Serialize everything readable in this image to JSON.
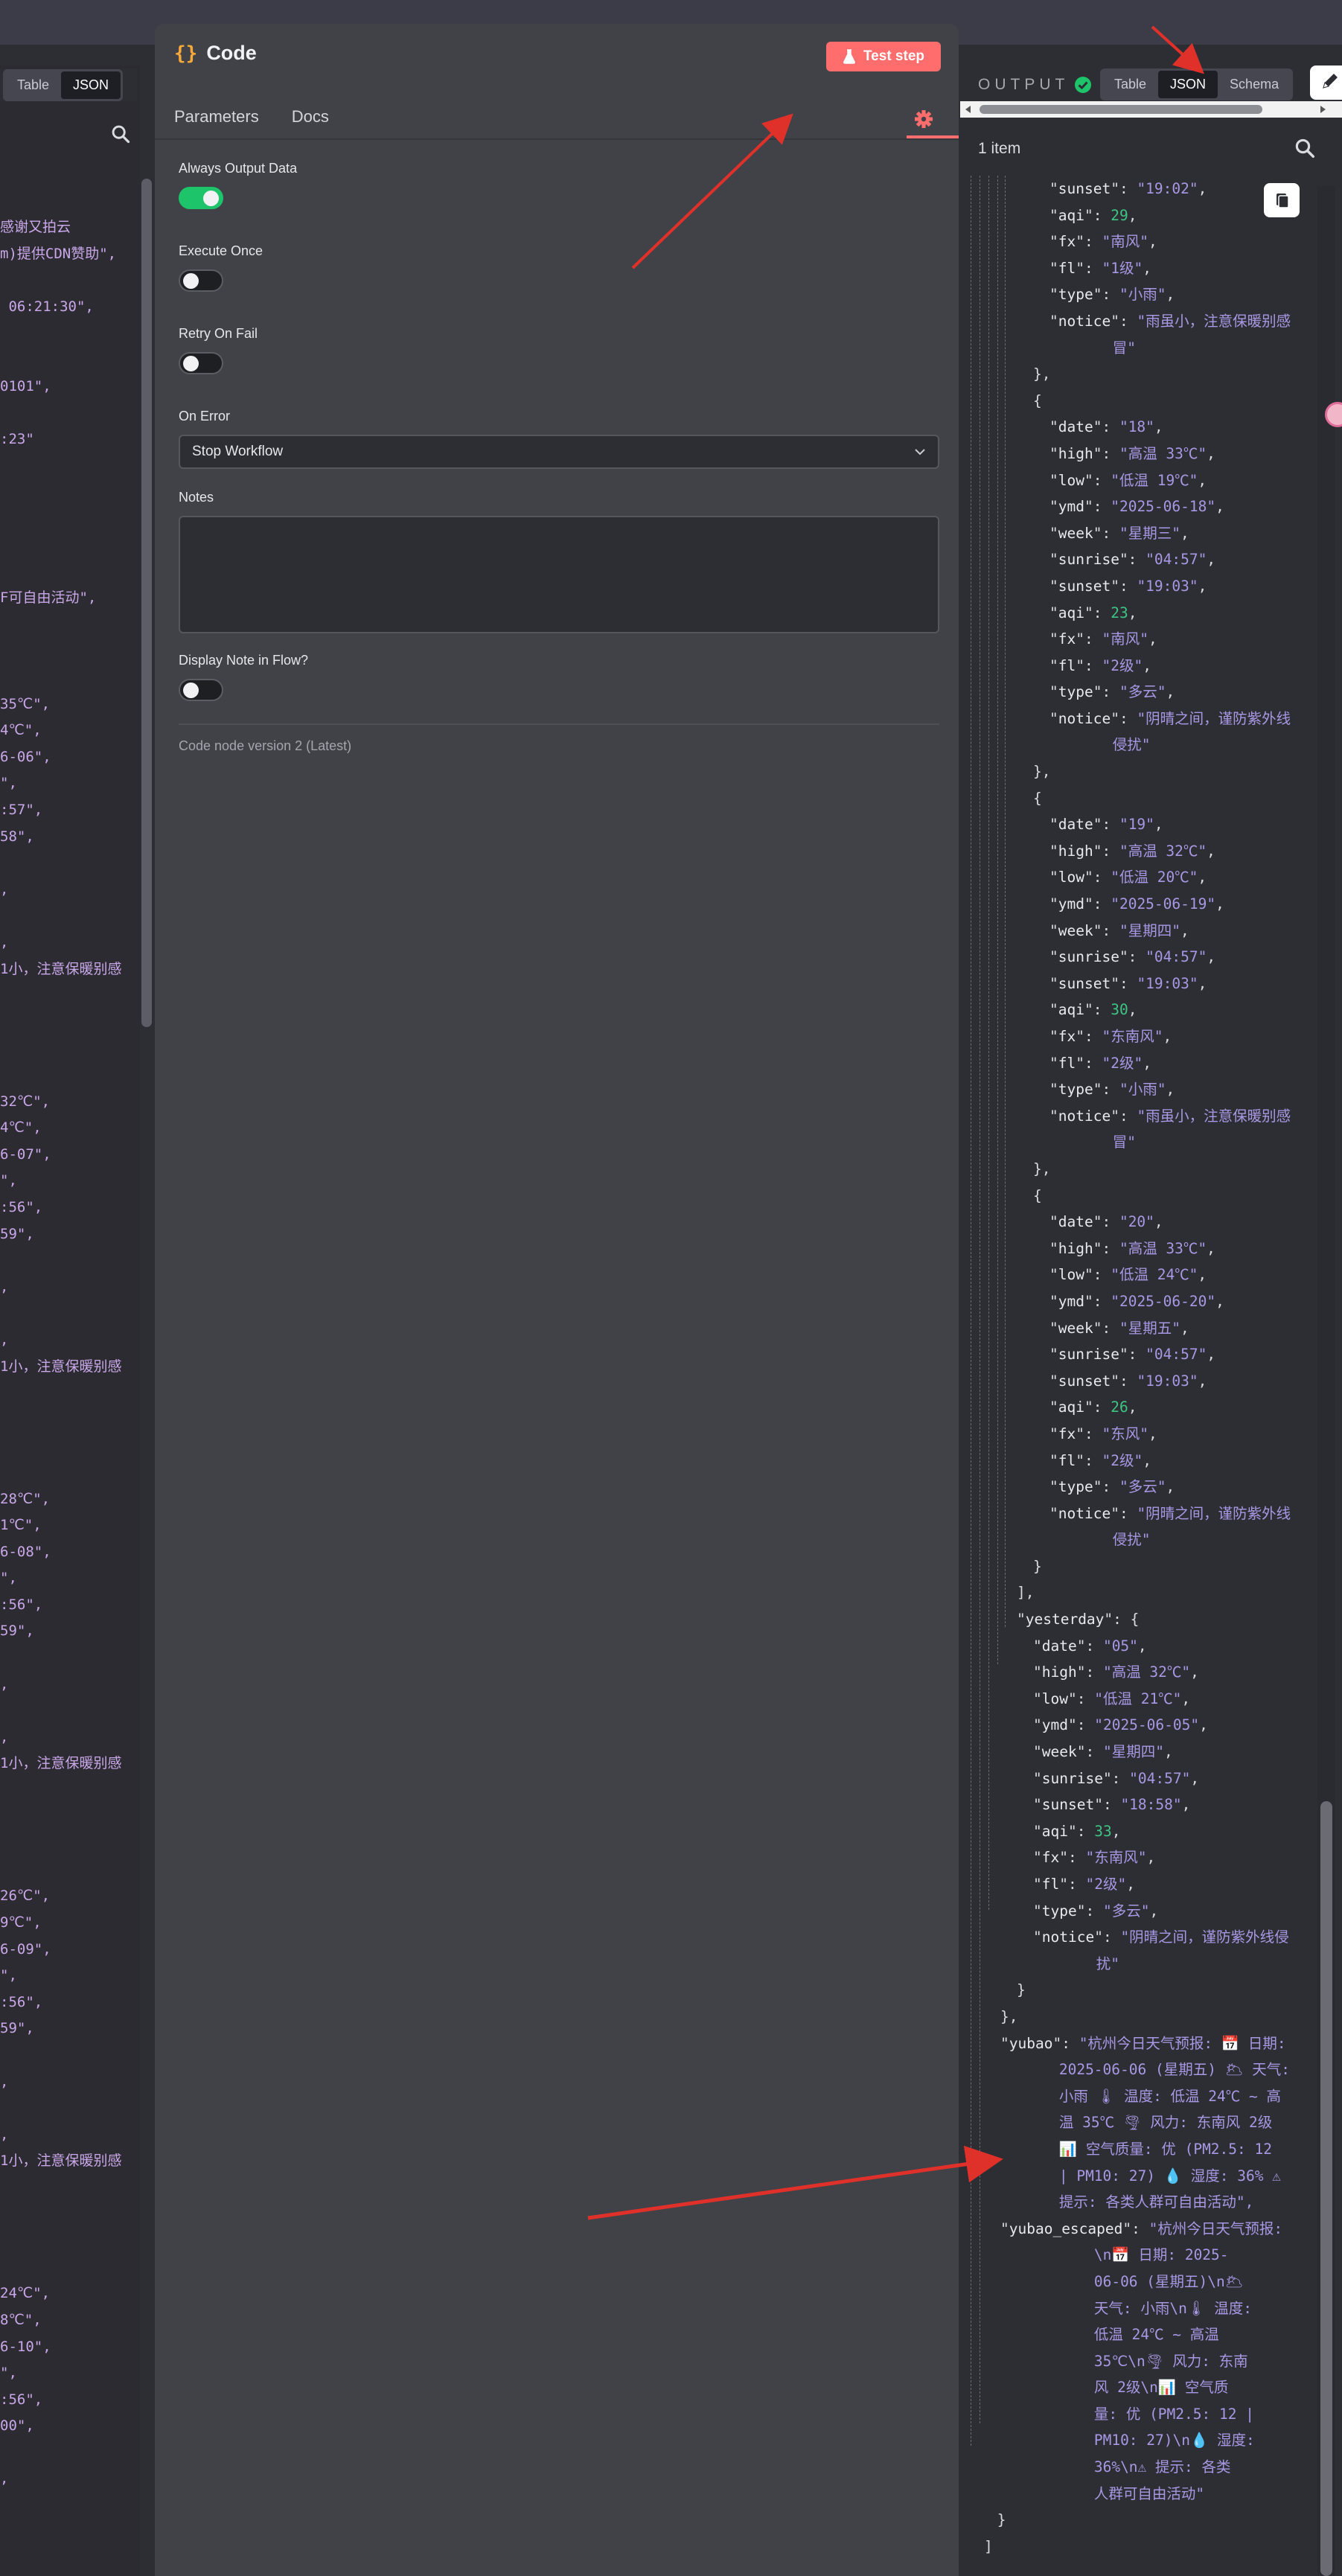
{
  "input_panel": {
    "view_toggle": {
      "table": "Table",
      "json": "JSON",
      "active": "JSON"
    },
    "code_fragments": [
      "感谢又拍云",
      "m)提供CDN赞助\",",
      "",
      " 06:21:30\",",
      "",
      "",
      "0101\",",
      "",
      ":23\"",
      "",
      "",
      "",
      "",
      "",
      "F可自由活动\",",
      "",
      "",
      "",
      "35℃\",",
      "4℃\",",
      "6-06\",",
      "\",",
      ":57\",",
      "58\",",
      "",
      ",",
      "",
      ",",
      "1小，注意保暖别感",
      "",
      "",
      "",
      "",
      "32℃\",",
      "4℃\",",
      "6-07\",",
      "\",",
      ":56\",",
      "59\",",
      "",
      ",",
      "",
      ",",
      "1小，注意保暖别感",
      "",
      "",
      "",
      "",
      "28℃\",",
      "1℃\",",
      "6-08\",",
      "\",",
      ":56\",",
      "59\",",
      "",
      ",",
      "",
      ",",
      "1小，注意保暖别感",
      "",
      "",
      "",
      "",
      "26℃\",",
      "9℃\",",
      "6-09\",",
      "\",",
      ":56\",",
      "59\",",
      "",
      ",",
      "",
      ",",
      "1小，注意保暖别感",
      "",
      "",
      "",
      "",
      "24℃\",",
      "8℃\",",
      "6-10\",",
      "\",",
      ":56\",",
      "00\",",
      "",
      ","
    ]
  },
  "node": {
    "title": "Code",
    "test_button": "Test step",
    "tabs": {
      "parameters": "Parameters",
      "docs": "Docs"
    },
    "settings": {
      "always_output_data": {
        "label": "Always Output Data",
        "on": true
      },
      "execute_once": {
        "label": "Execute Once",
        "on": false
      },
      "retry_on_fail": {
        "label": "Retry On Fail",
        "on": false
      },
      "on_error": {
        "label": "On Error",
        "value": "Stop Workflow"
      },
      "notes": {
        "label": "Notes",
        "value": ""
      },
      "display_note": {
        "label": "Display Note in Flow?",
        "on": false
      }
    },
    "version": "Code node version 2 (Latest)"
  },
  "output_panel": {
    "label": "OUTPUT",
    "view_toggle": {
      "table": "Table",
      "json": "JSON",
      "schema": "Schema",
      "active": "JSON"
    },
    "items_count": "1 item",
    "json_lines": [
      {
        "d": 4,
        "k": "sunset",
        "v": "\"19:02\"",
        "t": "s",
        "c": true
      },
      {
        "d": 4,
        "k": "aqi",
        "v": "29",
        "t": "n",
        "c": true
      },
      {
        "d": 4,
        "k": "fx",
        "v": "\"南风\"",
        "t": "s",
        "c": true
      },
      {
        "d": 4,
        "k": "fl",
        "v": "\"1级\"",
        "t": "s",
        "c": true
      },
      {
        "d": 4,
        "k": "type",
        "v": "\"小雨\"",
        "t": "s",
        "c": true
      },
      {
        "d": 4,
        "k": "notice",
        "v": "\"雨虽小，注意保暖别感",
        "t": "s",
        "c": false
      },
      {
        "d": 4,
        "w": 6.7,
        "v": "冒\"",
        "t": "s"
      },
      {
        "d": 3,
        "p": "},"
      },
      {
        "d": 3,
        "p": "{"
      },
      {
        "d": 4,
        "k": "date",
        "v": "\"18\"",
        "t": "s",
        "c": true
      },
      {
        "d": 4,
        "k": "high",
        "v": "\"高温 33℃\"",
        "t": "s",
        "c": true
      },
      {
        "d": 4,
        "k": "low",
        "v": "\"低温 19℃\"",
        "t": "s",
        "c": true
      },
      {
        "d": 4,
        "k": "ymd",
        "v": "\"2025-06-18\"",
        "t": "s",
        "c": true
      },
      {
        "d": 4,
        "k": "week",
        "v": "\"星期三\"",
        "t": "s",
        "c": true
      },
      {
        "d": 4,
        "k": "sunrise",
        "v": "\"04:57\"",
        "t": "s",
        "c": true
      },
      {
        "d": 4,
        "k": "sunset",
        "v": "\"19:03\"",
        "t": "s",
        "c": true
      },
      {
        "d": 4,
        "k": "aqi",
        "v": "23",
        "t": "n",
        "c": true
      },
      {
        "d": 4,
        "k": "fx",
        "v": "\"南风\"",
        "t": "s",
        "c": true
      },
      {
        "d": 4,
        "k": "fl",
        "v": "\"2级\"",
        "t": "s",
        "c": true
      },
      {
        "d": 4,
        "k": "type",
        "v": "\"多云\"",
        "t": "s",
        "c": true
      },
      {
        "d": 4,
        "k": "notice",
        "v": "\"阴晴之间，谨防紫外线",
        "t": "s",
        "c": false
      },
      {
        "d": 4,
        "w": 6.7,
        "v": "侵扰\"",
        "t": "s"
      },
      {
        "d": 3,
        "p": "},"
      },
      {
        "d": 3,
        "p": "{"
      },
      {
        "d": 4,
        "k": "date",
        "v": "\"19\"",
        "t": "s",
        "c": true
      },
      {
        "d": 4,
        "k": "high",
        "v": "\"高温 32℃\"",
        "t": "s",
        "c": true
      },
      {
        "d": 4,
        "k": "low",
        "v": "\"低温 20℃\"",
        "t": "s",
        "c": true
      },
      {
        "d": 4,
        "k": "ymd",
        "v": "\"2025-06-19\"",
        "t": "s",
        "c": true
      },
      {
        "d": 4,
        "k": "week",
        "v": "\"星期四\"",
        "t": "s",
        "c": true
      },
      {
        "d": 4,
        "k": "sunrise",
        "v": "\"04:57\"",
        "t": "s",
        "c": true
      },
      {
        "d": 4,
        "k": "sunset",
        "v": "\"19:03\"",
        "t": "s",
        "c": true
      },
      {
        "d": 4,
        "k": "aqi",
        "v": "30",
        "t": "n",
        "c": true
      },
      {
        "d": 4,
        "k": "fx",
        "v": "\"东南风\"",
        "t": "s",
        "c": true
      },
      {
        "d": 4,
        "k": "fl",
        "v": "\"2级\"",
        "t": "s",
        "c": true
      },
      {
        "d": 4,
        "k": "type",
        "v": "\"小雨\"",
        "t": "s",
        "c": true
      },
      {
        "d": 4,
        "k": "notice",
        "v": "\"雨虽小，注意保暖别感",
        "t": "s",
        "c": false
      },
      {
        "d": 4,
        "w": 6.7,
        "v": "冒\"",
        "t": "s"
      },
      {
        "d": 3,
        "p": "},"
      },
      {
        "d": 3,
        "p": "{"
      },
      {
        "d": 4,
        "k": "date",
        "v": "\"20\"",
        "t": "s",
        "c": true
      },
      {
        "d": 4,
        "k": "high",
        "v": "\"高温 33℃\"",
        "t": "s",
        "c": true
      },
      {
        "d": 4,
        "k": "low",
        "v": "\"低温 24℃\"",
        "t": "s",
        "c": true
      },
      {
        "d": 4,
        "k": "ymd",
        "v": "\"2025-06-20\"",
        "t": "s",
        "c": true
      },
      {
        "d": 4,
        "k": "week",
        "v": "\"星期五\"",
        "t": "s",
        "c": true
      },
      {
        "d": 4,
        "k": "sunrise",
        "v": "\"04:57\"",
        "t": "s",
        "c": true
      },
      {
        "d": 4,
        "k": "sunset",
        "v": "\"19:03\"",
        "t": "s",
        "c": true
      },
      {
        "d": 4,
        "k": "aqi",
        "v": "26",
        "t": "n",
        "c": true
      },
      {
        "d": 4,
        "k": "fx",
        "v": "\"东风\"",
        "t": "s",
        "c": true
      },
      {
        "d": 4,
        "k": "fl",
        "v": "\"2级\"",
        "t": "s",
        "c": true
      },
      {
        "d": 4,
        "k": "type",
        "v": "\"多云\"",
        "t": "s",
        "c": true
      },
      {
        "d": 4,
        "k": "notice",
        "v": "\"阴晴之间，谨防紫外线",
        "t": "s",
        "c": false
      },
      {
        "d": 4,
        "w": 6.7,
        "v": "侵扰\"",
        "t": "s"
      },
      {
        "d": 3,
        "p": "}"
      },
      {
        "d": 2,
        "p": "],"
      },
      {
        "d": 2,
        "k": "yesterday",
        "v": "{",
        "t": "p",
        "c": false
      },
      {
        "d": 3,
        "k": "date",
        "v": "\"05\"",
        "t": "s",
        "c": true
      },
      {
        "d": 3,
        "k": "high",
        "v": "\"高温 32℃\"",
        "t": "s",
        "c": true
      },
      {
        "d": 3,
        "k": "low",
        "v": "\"低温 21℃\"",
        "t": "s",
        "c": true
      },
      {
        "d": 3,
        "k": "ymd",
        "v": "\"2025-06-05\"",
        "t": "s",
        "c": true
      },
      {
        "d": 3,
        "k": "week",
        "v": "\"星期四\"",
        "t": "s",
        "c": true
      },
      {
        "d": 3,
        "k": "sunrise",
        "v": "\"04:57\"",
        "t": "s",
        "c": true
      },
      {
        "d": 3,
        "k": "sunset",
        "v": "\"18:58\"",
        "t": "s",
        "c": true
      },
      {
        "d": 3,
        "k": "aqi",
        "v": "33",
        "t": "n",
        "c": true
      },
      {
        "d": 3,
        "k": "fx",
        "v": "\"东南风\"",
        "t": "s",
        "c": true
      },
      {
        "d": 3,
        "k": "fl",
        "v": "\"2级\"",
        "t": "s",
        "c": true
      },
      {
        "d": 3,
        "k": "type",
        "v": "\"多云\"",
        "t": "s",
        "c": true
      },
      {
        "d": 3,
        "k": "notice",
        "v": "\"阴晴之间，谨防紫外线侵",
        "t": "s",
        "c": false
      },
      {
        "d": 3,
        "w": 6.7,
        "v": "扰\"",
        "t": "s"
      },
      {
        "d": 2,
        "p": "}"
      },
      {
        "d": 1,
        "p": "},"
      },
      {
        "d": 1,
        "k": "yubao",
        "v": "\"杭州今日天气预报: 📅 日期:",
        "t": "s",
        "c": false
      },
      {
        "d": 1,
        "w": 6.2,
        "v": "2025-06-06 (星期五) 🌥 天气:",
        "t": "s"
      },
      {
        "d": 1,
        "w": 6.2,
        "v": "小雨 🌡 温度: 低温 24℃ ~ 高",
        "t": "s"
      },
      {
        "d": 1,
        "w": 6.2,
        "v": "温 35℃ 🌪 风力: 东南风 2级",
        "t": "s"
      },
      {
        "d": 1,
        "w": 6.2,
        "v": "📊 空气质量: 优 (PM2.5: 12",
        "t": "s"
      },
      {
        "d": 1,
        "w": 6.2,
        "v": "| PM10: 27) 💧 湿度: 36% ⚠",
        "t": "s"
      },
      {
        "d": 1,
        "w": 6.2,
        "v": "提示: 各类人群可自由活动\",",
        "t": "s"
      },
      {
        "d": 1,
        "k": "yubao_escaped",
        "v": "\"杭州今日天气预报:",
        "t": "s",
        "c": false
      },
      {
        "d": 1,
        "w": 10.2,
        "v": "\\n📅 日期: 2025-",
        "t": "s"
      },
      {
        "d": 1,
        "w": 10.2,
        "v": "06-06 (星期五)\\n🌥",
        "t": "s"
      },
      {
        "d": 1,
        "w": 10.2,
        "v": "天气: 小雨\\n🌡 温度:",
        "t": "s"
      },
      {
        "d": 1,
        "w": 10.2,
        "v": "低温 24℃ ~ 高温",
        "t": "s"
      },
      {
        "d": 1,
        "w": 10.2,
        "v": "35℃\\n🌪 风力: 东南",
        "t": "s"
      },
      {
        "d": 1,
        "w": 10.2,
        "v": "风 2级\\n📊 空气质",
        "t": "s"
      },
      {
        "d": 1,
        "w": 10.2,
        "v": "量: 优 (PM2.5: 12 |",
        "t": "s"
      },
      {
        "d": 1,
        "w": 10.2,
        "v": "PM10: 27)\\n💧 湿度:",
        "t": "s"
      },
      {
        "d": 1,
        "w": 10.2,
        "v": "36%\\n⚠ 提示: 各类",
        "t": "s"
      },
      {
        "d": 1,
        "w": 10.2,
        "v": "人群可自由活动\"",
        "t": "s"
      },
      {
        "d": 0,
        "w": 1,
        "p": "}"
      },
      {
        "d": 0,
        "p": "]"
      }
    ]
  },
  "colors": {
    "accent": "#ff6d6d",
    "toggle_on": "#1ec46a",
    "json_string": "#a898e4",
    "json_number": "#3ec584",
    "annotation_arrow": "#e0302a"
  }
}
